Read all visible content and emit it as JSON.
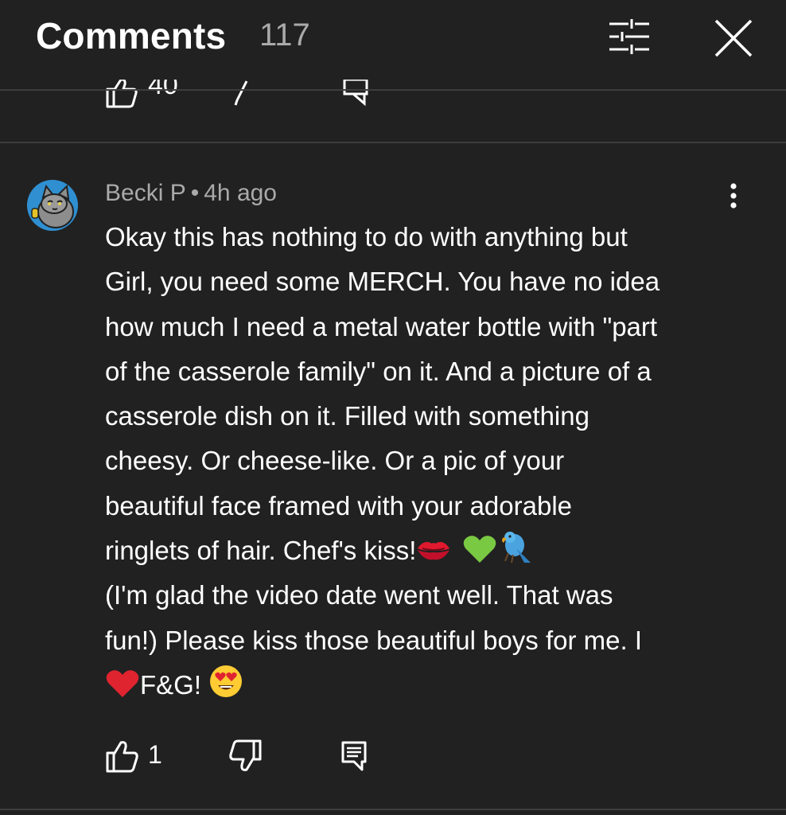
{
  "header": {
    "title": "Comments",
    "count": "117",
    "filter_icon": "sliders-icon",
    "close_icon": "close-icon"
  },
  "previous_comment": {
    "like_count": "40"
  },
  "comment": {
    "author": "Becki P",
    "separator": "•",
    "time": "4h ago",
    "lines": [
      "Okay this has nothing to do with anything but",
      "Girl, you need some MERCH. You have no idea",
      "how much I need a metal water bottle with \"part",
      "of the casserole family\" on it. And a picture of a",
      "casserole dish on it. Filled with something",
      "cheesy. Or cheese-like. Or a pic of your",
      "beautiful face framed with your adorable",
      "ringlets of hair. Chef's kiss!",
      "(I'm glad the video date went well. That was",
      "fun!) Please kiss those beautiful boys for me. I",
      "F&G!"
    ],
    "emojis_line8": [
      "kiss-mark-emoji",
      "green-heart-emoji",
      "parrot-emoji"
    ],
    "emoji_line11_start": "red-heart-emoji",
    "emoji_line11_end": "heart-eyes-emoji",
    "like_count": "1"
  },
  "colors": {
    "background": "#212121",
    "text_primary": "#ffffff",
    "text_secondary": "#aaaaaa",
    "divider": "#3d3d3d"
  }
}
